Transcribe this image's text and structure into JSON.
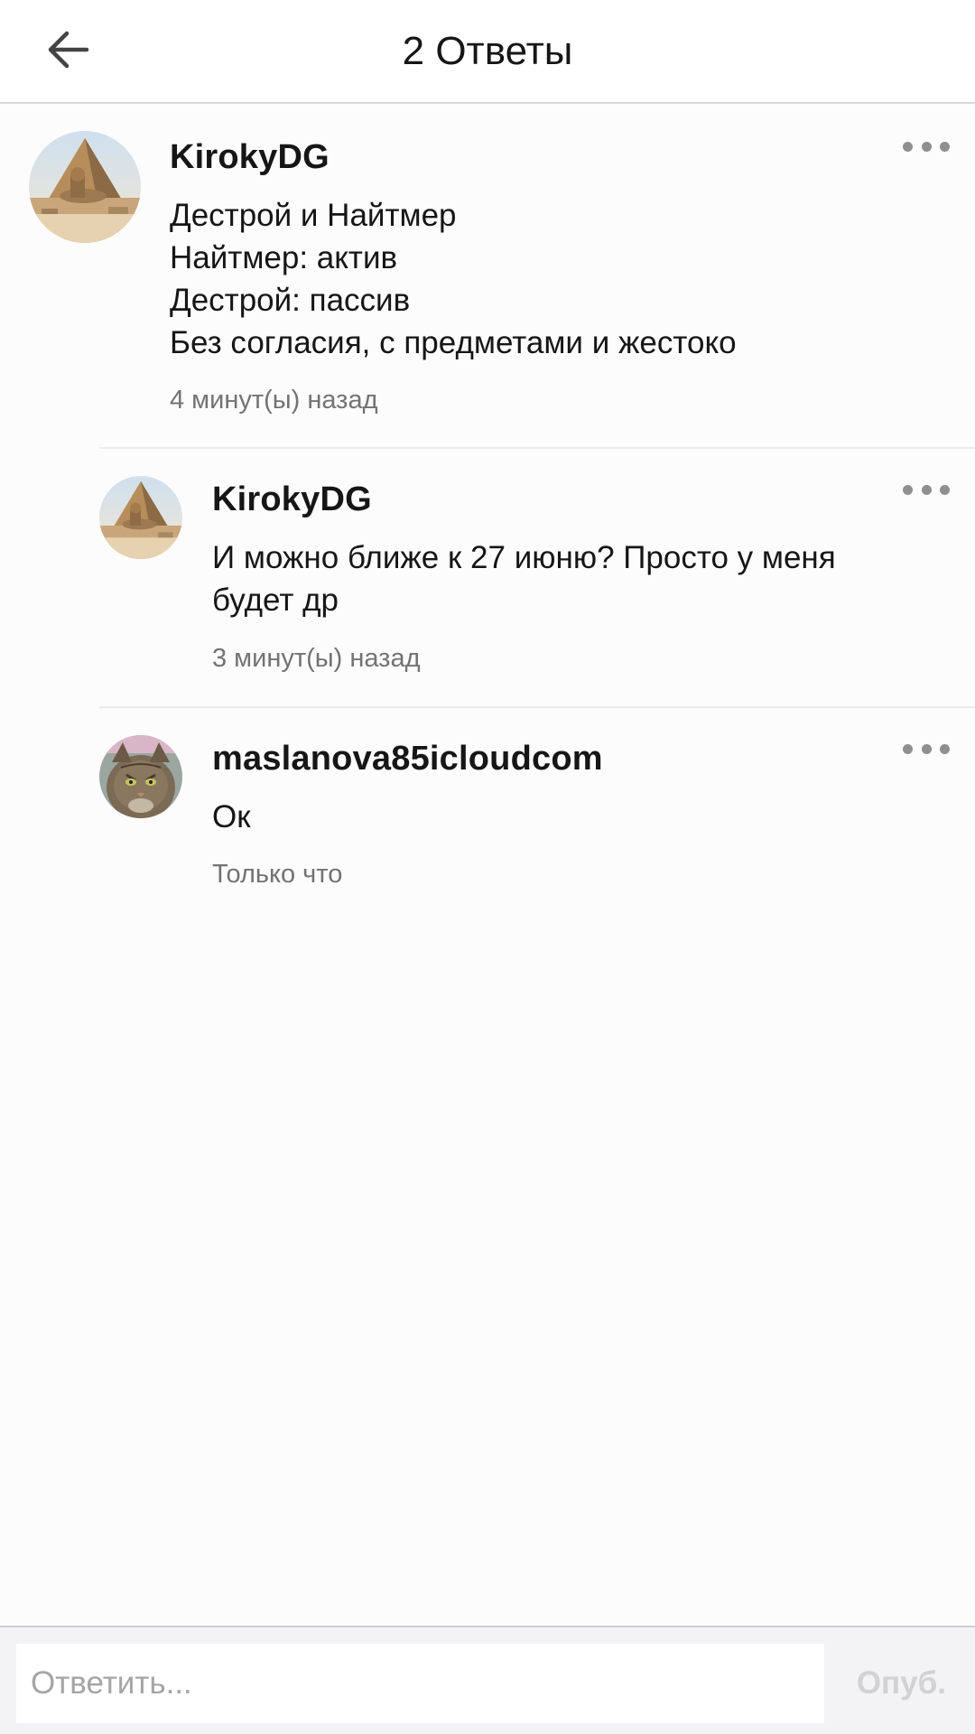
{
  "header": {
    "title": "2 Ответы",
    "back_icon": "arrow-left-icon"
  },
  "comments": [
    {
      "username": "KirokyDG",
      "avatar": "sphinx-pyramid-photo",
      "lines": [
        "Дестрой и Найтмер",
        "Найтмер: актив",
        "Дестрой: пассив",
        "Без согласия, с предметами и жестоко"
      ],
      "time": "4 минут(ы) назад",
      "more_icon": "more-dots-icon"
    },
    {
      "username": "KirokyDG",
      "avatar": "sphinx-pyramid-photo",
      "lines": [
        "И можно ближе к 27 июню? Просто у меня",
        "будет др"
      ],
      "time": "3 минут(ы) назад",
      "more_icon": "more-dots-icon"
    },
    {
      "username": "maslanova85icloudcom",
      "avatar": "cat-photo",
      "lines": [
        "Ок"
      ],
      "time": "Только что",
      "more_icon": "more-dots-icon"
    }
  ],
  "reply": {
    "placeholder": "Ответить...",
    "publish_label": "Опуб."
  },
  "colors": {
    "text": "#161616",
    "muted": "#737373",
    "divider": "#ececec",
    "publish_disabled": "#d2d2d2"
  }
}
